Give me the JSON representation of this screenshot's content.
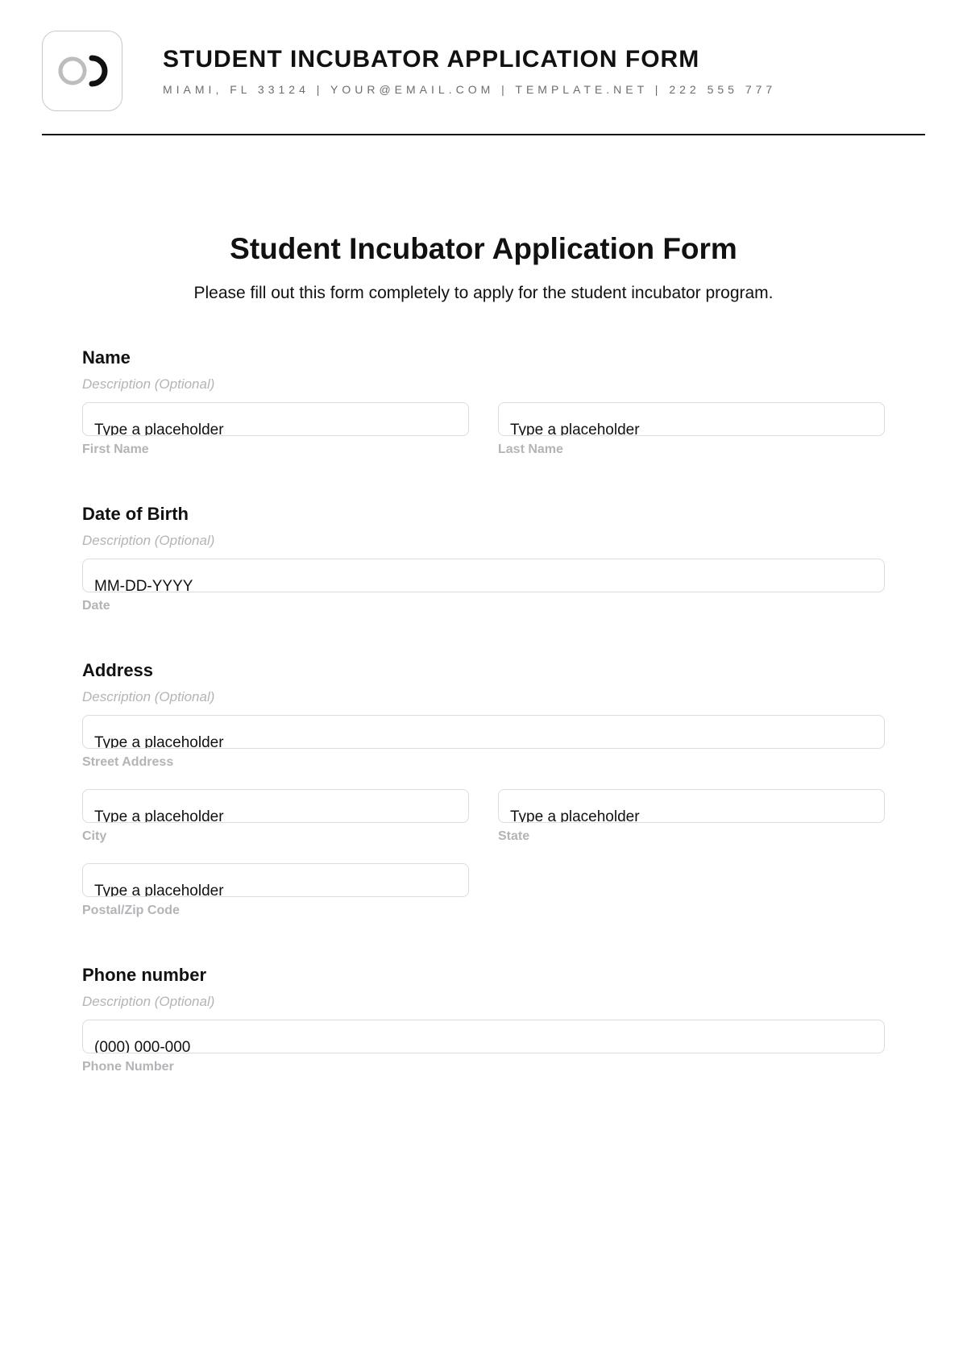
{
  "header": {
    "title": "STUDENT INCUBATOR APPLICATION FORM",
    "contact": "MIAMI, FL 33124 | YOUR@EMAIL.COM | TEMPLATE.NET | 222 555 777"
  },
  "form": {
    "title": "Student Incubator Application Form",
    "intro": "Please fill out this form completely to apply for the student incubator program.",
    "name": {
      "label": "Name",
      "desc": "Description (Optional)",
      "first": {
        "placeholder": "Type a placeholder",
        "sublabel": "First Name"
      },
      "last": {
        "placeholder": "Type a placeholder",
        "sublabel": "Last Name"
      }
    },
    "dob": {
      "label": "Date of Birth",
      "desc": "Description (Optional)",
      "date": {
        "placeholder": "MM-DD-YYYY",
        "sublabel": "Date"
      }
    },
    "address": {
      "label": "Address",
      "desc": "Description (Optional)",
      "street": {
        "placeholder": "Type a placeholder",
        "sublabel": "Street Address"
      },
      "city": {
        "placeholder": "Type a placeholder",
        "sublabel": "City"
      },
      "state": {
        "placeholder": "Type a placeholder",
        "sublabel": "State"
      },
      "postal": {
        "placeholder": "Type a placeholder",
        "sublabel": "Postal/Zip Code"
      }
    },
    "phone": {
      "label": "Phone number",
      "desc": "Description (Optional)",
      "number": {
        "placeholder": "(000) 000-000",
        "sublabel": "Phone Number"
      }
    }
  }
}
